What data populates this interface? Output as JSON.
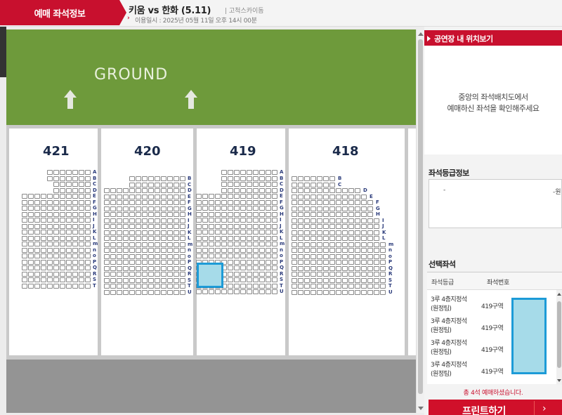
{
  "header": {
    "tab_label": "예매 좌석정보",
    "game_title": "키움 vs 한화 (5.11)",
    "venue": "| 고척스카이돔",
    "date_text": "이용일시 : 2025년 05월 11일 오후 14시 00분"
  },
  "map": {
    "ground_label": "GROUND",
    "sections": [
      {
        "id": "421",
        "rows": [
          "A",
          "B",
          "C",
          "D",
          "E",
          "F",
          "G",
          "H",
          "I",
          "J",
          "K",
          "L",
          "m",
          "n",
          "o",
          "P",
          "Q",
          "R",
          "S",
          "T"
        ]
      },
      {
        "id": "420",
        "rows": [
          "B",
          "C",
          "D",
          "E",
          "F",
          "G",
          "H",
          "I",
          "J",
          "K",
          "L",
          "m",
          "n",
          "o",
          "P",
          "Q",
          "R",
          "S",
          "T",
          "U"
        ]
      },
      {
        "id": "419",
        "rows": [
          "A",
          "B",
          "C",
          "D",
          "E",
          "F",
          "G",
          "H",
          "I",
          "J",
          "K",
          "L",
          "m",
          "n",
          "o",
          "P",
          "Q",
          "R",
          "S",
          "T",
          "U"
        ]
      },
      {
        "id": "418",
        "rows": [
          "B",
          "C",
          "D",
          "E",
          "F",
          "G",
          "H",
          "I",
          "J",
          "K",
          "L",
          "m",
          "n",
          "o",
          "P",
          "Q",
          "R",
          "S",
          "T",
          "U"
        ]
      }
    ]
  },
  "panel": {
    "minimap_title": "공연장 내 위치보기",
    "minimap_message_1": "중앙의 좌석배치도에서",
    "minimap_message_2": "예매하신 좌석을 확인해주세요",
    "grade_info_title": "좌석등급정보",
    "grade_dash": "-",
    "grade_price": "-원",
    "selected_title": "선택좌석",
    "col_grade": "좌석등급",
    "col_seat": "좌석번호",
    "selected": [
      {
        "grade_1": "3루 4층지정석",
        "grade_2": "(원정팀)",
        "zone": "419구역"
      },
      {
        "grade_1": "3루 4층지정석",
        "grade_2": "(원정팀)",
        "zone": "419구역"
      },
      {
        "grade_1": "3루 4층지정석",
        "grade_2": "(원정팀)",
        "zone": "419구역"
      },
      {
        "grade_1": "3루 4층지정석",
        "grade_2": "(원정팀)",
        "zone": "419구역"
      }
    ],
    "total_text": "총 4석 예매하셨습니다.",
    "print_label": "프린트하기"
  },
  "colors": {
    "brand_red": "#c8102e",
    "ground_green": "#6e9a3b",
    "selected_fill": "#a6dbe9",
    "selected_border": "#1d9bd7"
  }
}
